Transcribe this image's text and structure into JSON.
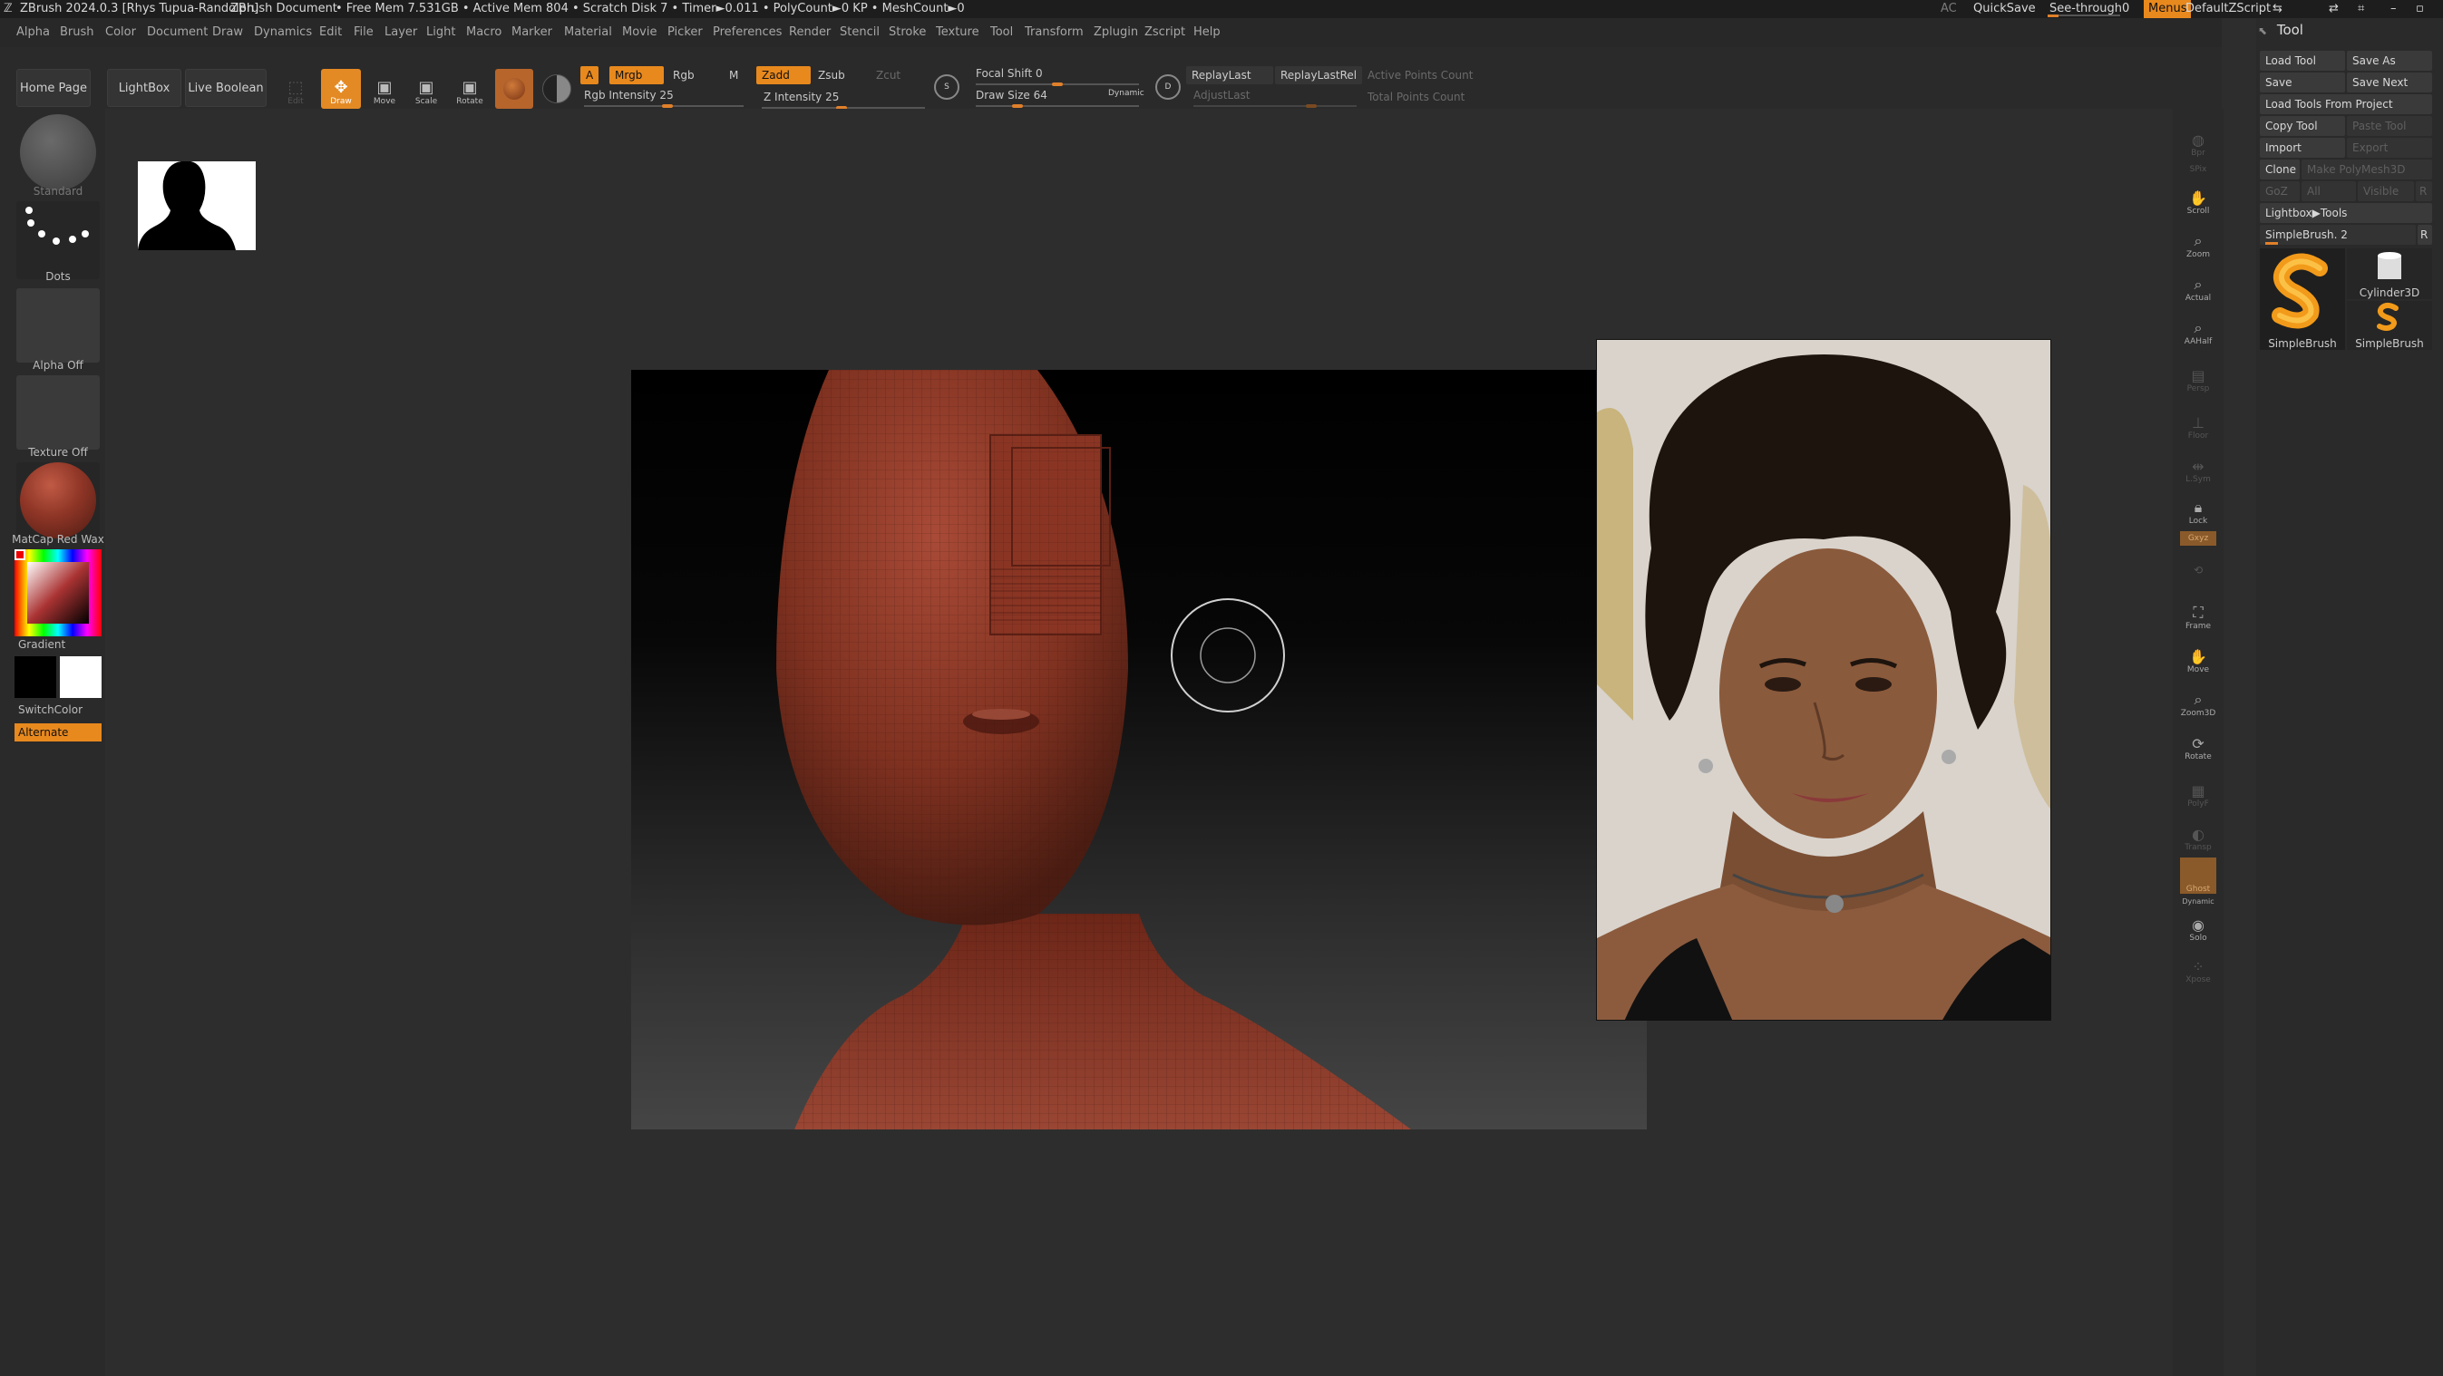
{
  "titlebar": {
    "app": "ZBrush 2024.0.3 [Rhys Tupua-Randolph]",
    "doc": "ZBrush Document",
    "stats": "• Free Mem 7.531GB • Active Mem 804 • Scratch Disk 7 • Timer►0.011 • PolyCount►0 KP • MeshCount►0",
    "ac": "AC",
    "quicksave": "QuickSave",
    "seethrough": "See-through",
    "seethrough_value": "0",
    "menus": "Menus",
    "defaultzscript": "DefaultZScript"
  },
  "menubar": [
    "Alpha",
    "Brush",
    "Color",
    "Document",
    "Draw",
    "Dynamics",
    "Edit",
    "File",
    "Layer",
    "Light",
    "Macro",
    "Marker",
    "Material",
    "Movie",
    "Picker",
    "Preferences",
    "Render",
    "Stencil",
    "Stroke",
    "Texture",
    "Tool",
    "Transform",
    "Zplugin",
    "Zscript",
    "Help"
  ],
  "toolbar": {
    "home_page": "Home Page",
    "lightbox": "LightBox",
    "live_boolean": "Live Boolean",
    "edit": "Edit",
    "draw": "Draw",
    "move": "Move",
    "scale": "Scale",
    "rotate": "Rotate",
    "a": "A",
    "mrgb": "Mrgb",
    "rgb": "Rgb",
    "m": "M",
    "zadd": "Zadd",
    "zsub": "Zsub",
    "zcut": "Zcut",
    "rgb_intensity": "Rgb Intensity 25",
    "z_intensity": "Z Intensity 25",
    "focal_shift": "Focal Shift 0",
    "draw_size": "Draw Size 64",
    "dynamic": "Dynamic",
    "replay_last": "ReplayLast",
    "replay_last_rel": "ReplayLastRel",
    "adjust_last": "AdjustLast",
    "active_points": "Active Points Count",
    "total_points": "Total Points Count"
  },
  "leftshelf": {
    "brush": "Standard",
    "stroke": "Dots",
    "alpha": "Alpha Off",
    "texture": "Texture Off",
    "material": "MatCap Red Wax",
    "gradient": "Gradient",
    "switch_color": "SwitchColor",
    "alternate": "Alternate"
  },
  "rightshelf": [
    "Bpr",
    "SPix",
    "Scroll",
    "Zoom",
    "Actual",
    "AAHalf",
    "Persp",
    "Floor",
    "L.Sym",
    "Lock",
    "Gxyz",
    "Frame",
    "Move",
    "Zoom3D",
    "Rotate",
    "PolyF",
    "Transp",
    "Ghost",
    "Dynamic",
    "Solo",
    "Xpose"
  ],
  "toolpanel": {
    "title": "Tool",
    "load_tool": "Load Tool",
    "save_as": "Save As",
    "save": "Save",
    "save_next": "Save Next",
    "load_tools_from_project": "Load Tools From Project",
    "copy_tool": "Copy Tool",
    "paste_tool": "Paste Tool",
    "import": "Import",
    "export": "Export",
    "clone": "Clone",
    "make_polymesh": "Make PolyMesh3D",
    "goz": "GoZ",
    "all": "All",
    "visible": "Visible",
    "r": "R",
    "lightbox_tools": "Lightbox▶Tools",
    "current_tool": "SimpleBrush. 2",
    "thumb_1": "SimpleBrush",
    "thumb_2": "Cylinder3D",
    "thumb_3": "SimpleBrush"
  },
  "colors": {
    "accent": "#e8891e",
    "bg": "#2d2d2d",
    "clay": "#8e3a2a"
  }
}
